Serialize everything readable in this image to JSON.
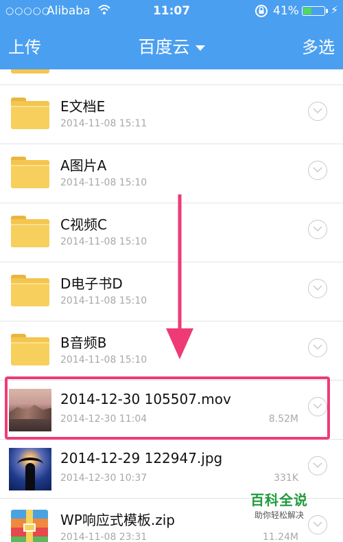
{
  "status_bar": {
    "carrier_dots": "○○○○○",
    "carrier": "Alibaba",
    "wifi_icon": "wifi-icon",
    "time": "11:07",
    "lock_icon": "orientation-lock-icon",
    "battery_percent": "41%",
    "battery_level": 0.41,
    "battery_fill_color": "#4cd964",
    "charging_icon": "⚡"
  },
  "nav_bar": {
    "left_label": "上传",
    "title": "百度云",
    "right_label": "多选",
    "background_color": "#4a9ff0"
  },
  "files": [
    {
      "type": "folder",
      "name": "E文档E",
      "date": "2014-11-08 15:11",
      "size": ""
    },
    {
      "type": "folder",
      "name": "A图片A",
      "date": "2014-11-08 15:10",
      "size": ""
    },
    {
      "type": "folder",
      "name": "C视频C",
      "date": "2014-11-08 15:10",
      "size": ""
    },
    {
      "type": "folder",
      "name": "D电子书D",
      "date": "2014-11-08 15:10",
      "size": ""
    },
    {
      "type": "folder",
      "name": "B音频B",
      "date": "2014-11-08 15:10",
      "size": ""
    },
    {
      "type": "video",
      "name": "2014-12-30 105507.mov",
      "date": "2014-12-30 11:04",
      "size": "8.52M"
    },
    {
      "type": "image",
      "name": "2014-12-29 122947.jpg",
      "date": "2014-12-30 10:37",
      "size": "331K"
    },
    {
      "type": "zip",
      "name": "WP响应式模板.zip",
      "date": "2014-11-08 23:31",
      "size": "11.24M"
    }
  ],
  "annotation": {
    "highlight_color": "#ee3b76"
  },
  "watermark": {
    "title": "百科全说",
    "subtitle": "助你轻松解决"
  }
}
